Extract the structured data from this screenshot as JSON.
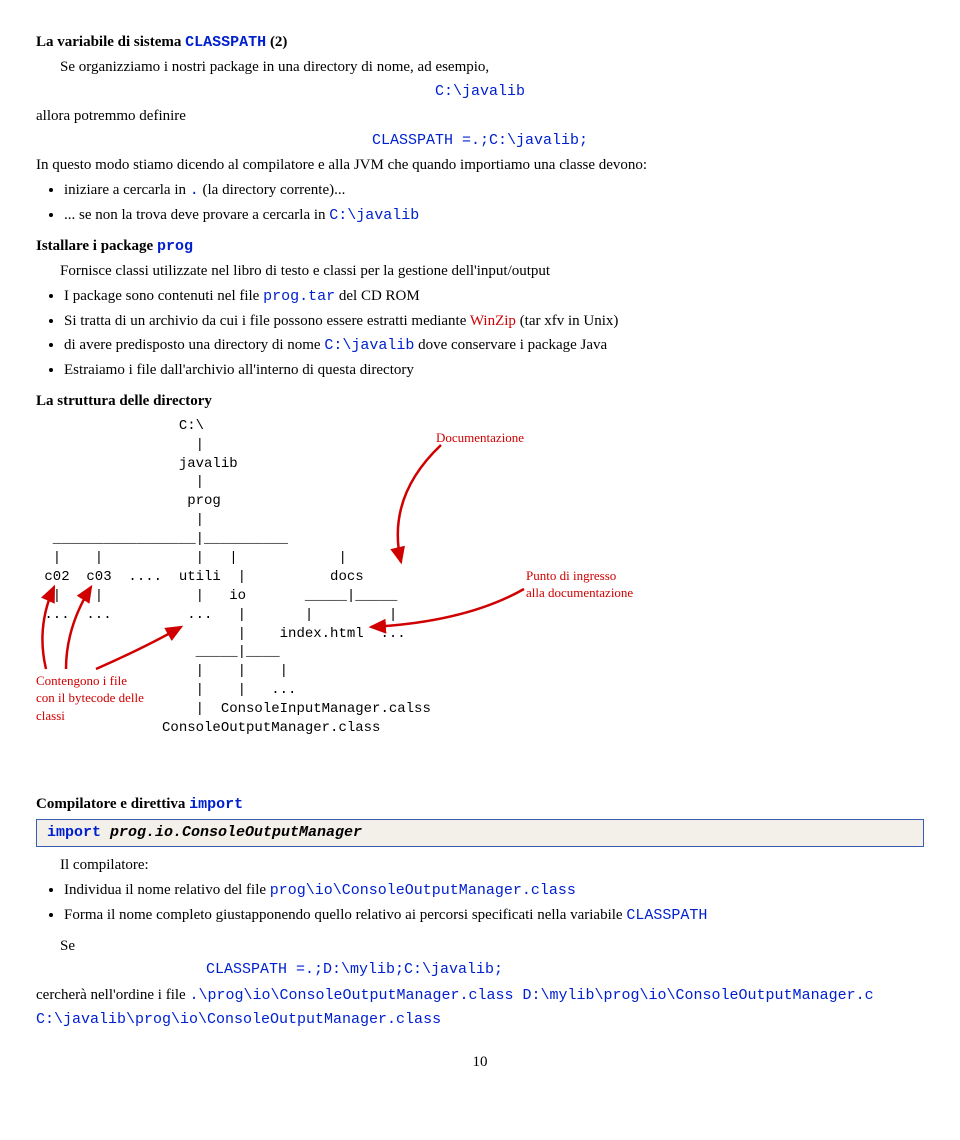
{
  "h1": {
    "pre": "La variabile di sistema ",
    "classpath": "CLASSPATH",
    "suf": " (2)"
  },
  "p1": "Se organizziamo i nostri package in una directory di nome, ad esempio,",
  "ex1": "C:\\javalib",
  "p2": "allora potremmo definire",
  "ex2pre": "CLASSPATH =",
  "ex2suf": ".;C:\\javalib;",
  "p3": "In questo modo stiamo dicendo al compilatore e alla JVM che quando importiamo una classe devono:",
  "b1a": "iniziare a cercarla in ",
  "b1dot": ".",
  "b1b": " (la directory corrente)...",
  "b2a": "... se non la trova deve provare a cercarla in ",
  "b2b": "C:\\javalib",
  "h2a": "Istallare i package ",
  "h2b": "prog",
  "p4": "Fornisce classi utilizzate nel libro di testo e classi per la gestione dell'input/output",
  "i1a": "I package sono contenuti nel file ",
  "i1b": "prog.tar",
  "i1c": " del CD ROM",
  "i2a": "Si tratta di un archivio da cui i file possono essere estratti mediante ",
  "i2b": "WinZip",
  "i2c": " (tar xfv in Unix)",
  "i3a": "di avere predisposto una directory di nome ",
  "i3b": "C:\\javalib",
  "i3c": " dove conservare i package Java",
  "i4": "Estraiamo i file dall'archivio all'interno di questa directory",
  "h3": "La struttura delle directory",
  "tree": "                 C:\\\n                   |\n                 javalib\n                   |\n                  prog\n                   |\n  _________________|__________\n  |    |           |   |            |\n c02  c03  ....  utili  |          docs\n  |    |           |   io       _____|_____\n ...  ...         ...   |       |         |\n                        |    index.html  ...\n                   _____|____\n                   |    |    |\n                   |    |   ...\n                   |  ConsoleInputManager.calss\n               ConsoleOutputManager.class",
  "anno1": "Documentazione",
  "anno2a": "Punto di ingresso",
  "anno2b": "alla documentazione",
  "anno3a": "Contengono i file",
  "anno3b": "con il bytecode delle",
  "anno3c": "classi",
  "h4a": "Compilatore e direttiva ",
  "h4b": "import",
  "code1a": "import",
  "code1b": " prog.io.ConsoleOutputManager",
  "p5": "Il compilatore:",
  "c1a": "Individua il nome relativo del file ",
  "c1b": "prog\\io\\ConsoleOutputManager.class",
  "c2a": "Forma il nome completo giustapponendo quello relativo ai percorsi specificati nella variabile ",
  "c2b": "CLASSPATH",
  "p6": "Se",
  "ex3pre": "CLASSPATH =",
  "ex3suf": ".;D:\\mylib;C:\\javalib;",
  "p7a": "cercherà nell'ordine i file ",
  "p7b": ".\\prog\\io\\ConsoleOutputManager.class",
  "p7c": " D:\\mylib\\prog\\io\\ConsoleOutputManager.c",
  "p8": "C:\\javalib\\prog\\io\\ConsoleOutputManager.class",
  "page": "10"
}
